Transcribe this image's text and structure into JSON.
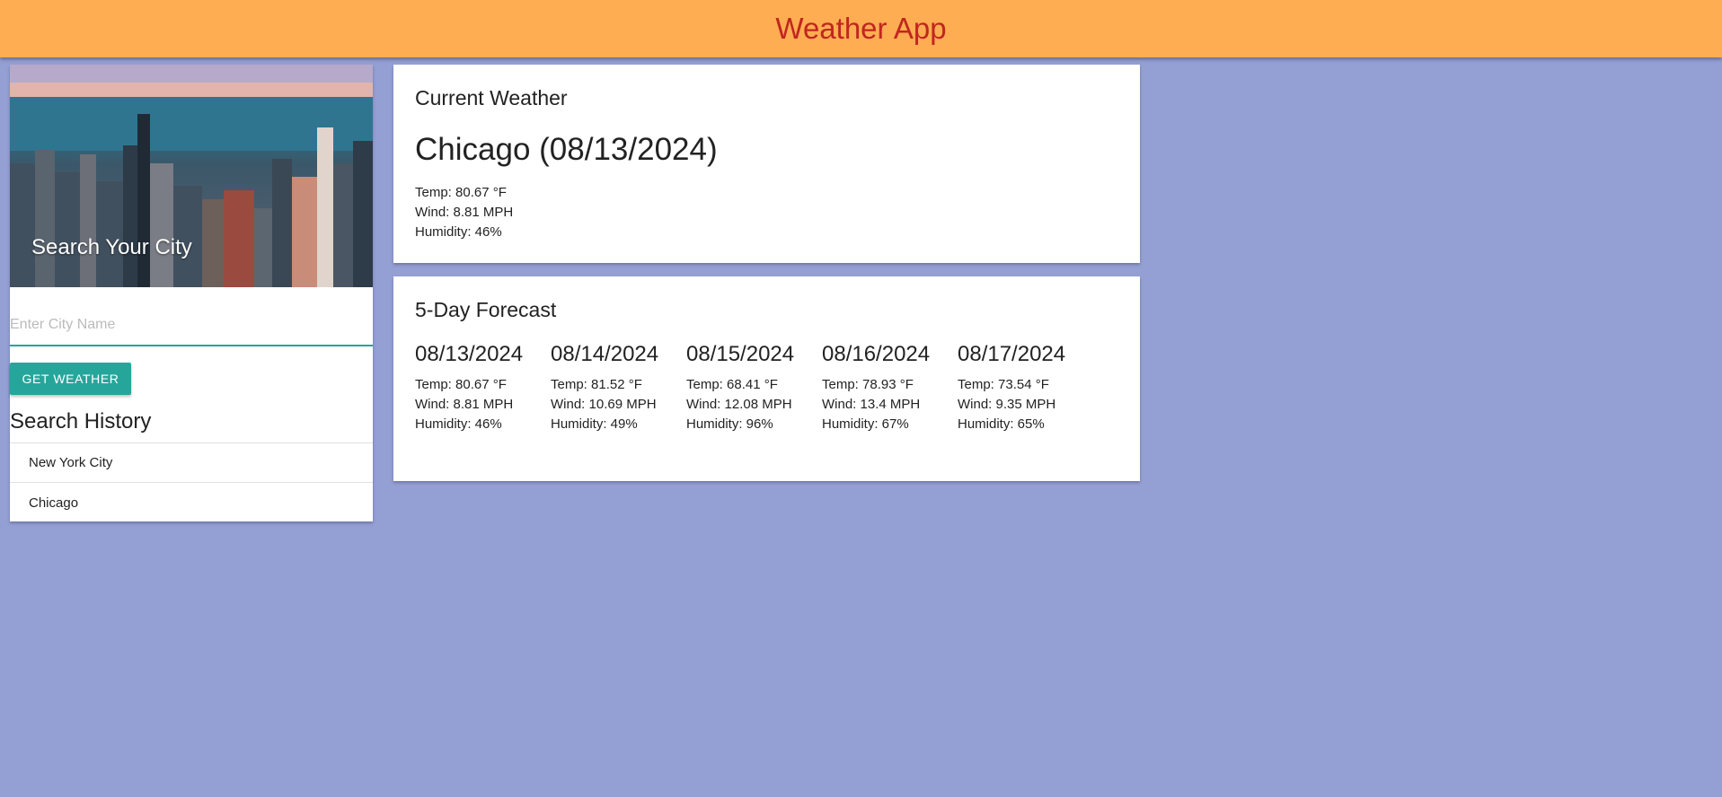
{
  "header": {
    "title": "Weather App"
  },
  "search": {
    "image_title": "Search Your City",
    "placeholder": "Enter City Name",
    "value": "",
    "button_label": "GET WEATHER",
    "history_title": "Search History",
    "history": [
      "New York City",
      "Chicago"
    ]
  },
  "current": {
    "title": "Current Weather",
    "city_date": "Chicago (08/13/2024)",
    "temp": "Temp: 80.67 °F",
    "wind": "Wind: 8.81 MPH",
    "humidity": "Humidity: 46%"
  },
  "forecast": {
    "title": "5-Day Forecast",
    "days": [
      {
        "date": "08/13/2024",
        "temp": "Temp: 80.67 °F",
        "wind": "Wind: 8.81 MPH",
        "humidity": "Humidity: 46%"
      },
      {
        "date": "08/14/2024",
        "temp": "Temp: 81.52 °F",
        "wind": "Wind: 10.69 MPH",
        "humidity": "Humidity: 49%"
      },
      {
        "date": "08/15/2024",
        "temp": "Temp: 68.41 °F",
        "wind": "Wind: 12.08 MPH",
        "humidity": "Humidity: 96%"
      },
      {
        "date": "08/16/2024",
        "temp": "Temp: 78.93 °F",
        "wind": "Wind: 13.4 MPH",
        "humidity": "Humidity: 67%"
      },
      {
        "date": "08/17/2024",
        "temp": "Temp: 73.54 °F",
        "wind": "Wind: 9.35 MPH",
        "humidity": "Humidity: 65%"
      }
    ]
  },
  "colors": {
    "background": "#949fd4",
    "header": "#ffad52",
    "title": "#c0261f",
    "accent": "#26a69a"
  }
}
